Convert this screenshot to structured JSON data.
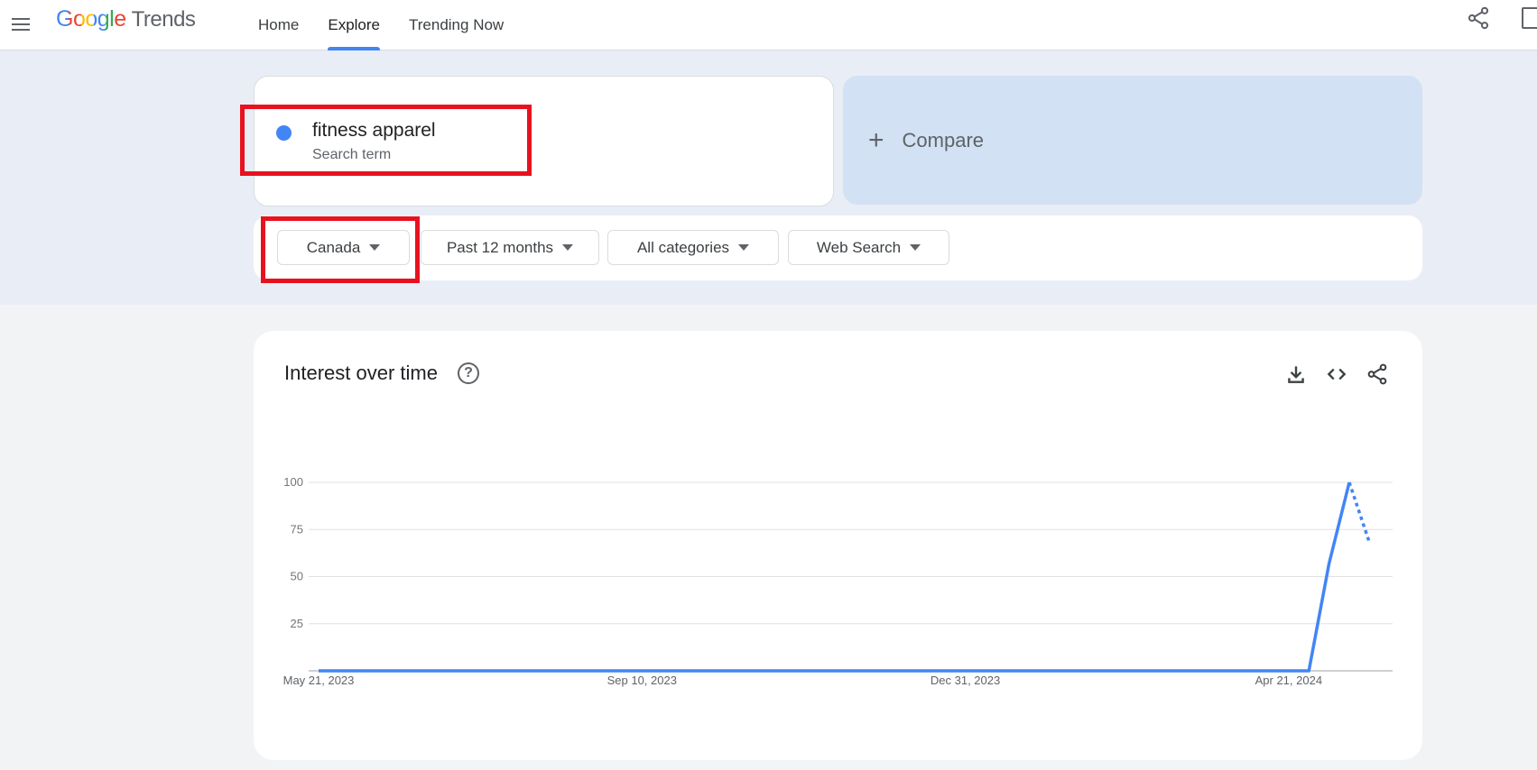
{
  "header": {
    "logo_google": "Google",
    "logo_trends": "Trends",
    "nav": [
      "Home",
      "Explore",
      "Trending Now"
    ],
    "active_nav": "Explore"
  },
  "search": {
    "term": "fitness apparel",
    "term_type": "Search term",
    "term_color": "#4285f4",
    "compare_label": "Compare"
  },
  "filters": {
    "region": "Canada",
    "time_range": "Past 12 months",
    "category": "All categories",
    "search_type": "Web Search"
  },
  "chart": {
    "title": "Interest over time",
    "icons": [
      "download-icon",
      "embed-code-icon",
      "share-icon"
    ]
  },
  "chart_data": {
    "type": "line",
    "title": "Interest over time",
    "y_ticks": [
      25,
      50,
      75,
      100
    ],
    "x_tick_labels": [
      "May 21, 2023",
      "Sep 10, 2023",
      "Dec 31, 2023",
      "Apr 21, 2024"
    ],
    "ylim": [
      0,
      100
    ],
    "grid": true,
    "series": [
      {
        "name": "fitness apparel",
        "color": "#4285f4",
        "x": [
          "2023-05-21",
          "2023-06-04",
          "2023-07-02",
          "2023-08-06",
          "2023-09-10",
          "2023-10-15",
          "2023-11-19",
          "2023-12-31",
          "2024-02-04",
          "2024-03-10",
          "2024-04-21",
          "2024-04-28",
          "2024-05-05",
          "2024-05-12"
        ],
        "values": [
          0,
          0,
          0,
          0,
          0,
          0,
          0,
          0,
          0,
          0,
          0,
          0,
          57,
          100
        ],
        "partial_x": [
          "2024-05-12",
          "2024-05-19"
        ],
        "partial_values": [
          100,
          68
        ]
      }
    ]
  }
}
